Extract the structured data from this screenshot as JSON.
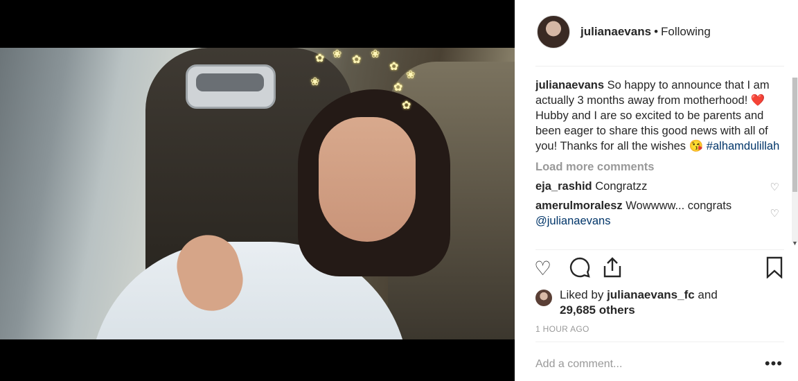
{
  "post": {
    "username": "julianaevans",
    "separator": "•",
    "follow_state": "Following",
    "caption_user": "julianaevans",
    "caption_text_1": "So happy to announce that I am actually 3 months away from motherhood!",
    "caption_emoji_1": "❤️",
    "caption_text_2": "Hubby and I are so excited to be parents and been eager to share this good news with all of you! Thanks for all the wishes",
    "caption_emoji_2": "😘",
    "caption_hashtag": "#alhamdulillah",
    "load_more": "Load more comments",
    "comments": [
      {
        "user": "eja_rashid",
        "text": "Congratzz"
      },
      {
        "user": "amerulmoralesz",
        "text": "Wowwww... congrats",
        "mention": "@julianaevans"
      }
    ],
    "liked_prefix": "Liked by",
    "liked_user": "julianaevans_fc",
    "liked_and": "and",
    "liked_count": "29,685 others",
    "timestamp": "1 HOUR AGO",
    "add_comment_placeholder": "Add a comment...",
    "more_options": "•••"
  },
  "icons": {
    "like": "heart-outline-icon",
    "comment": "comment-bubble-icon",
    "share": "share-icon",
    "save": "bookmark-icon",
    "comment_like": "small-heart-icon"
  }
}
